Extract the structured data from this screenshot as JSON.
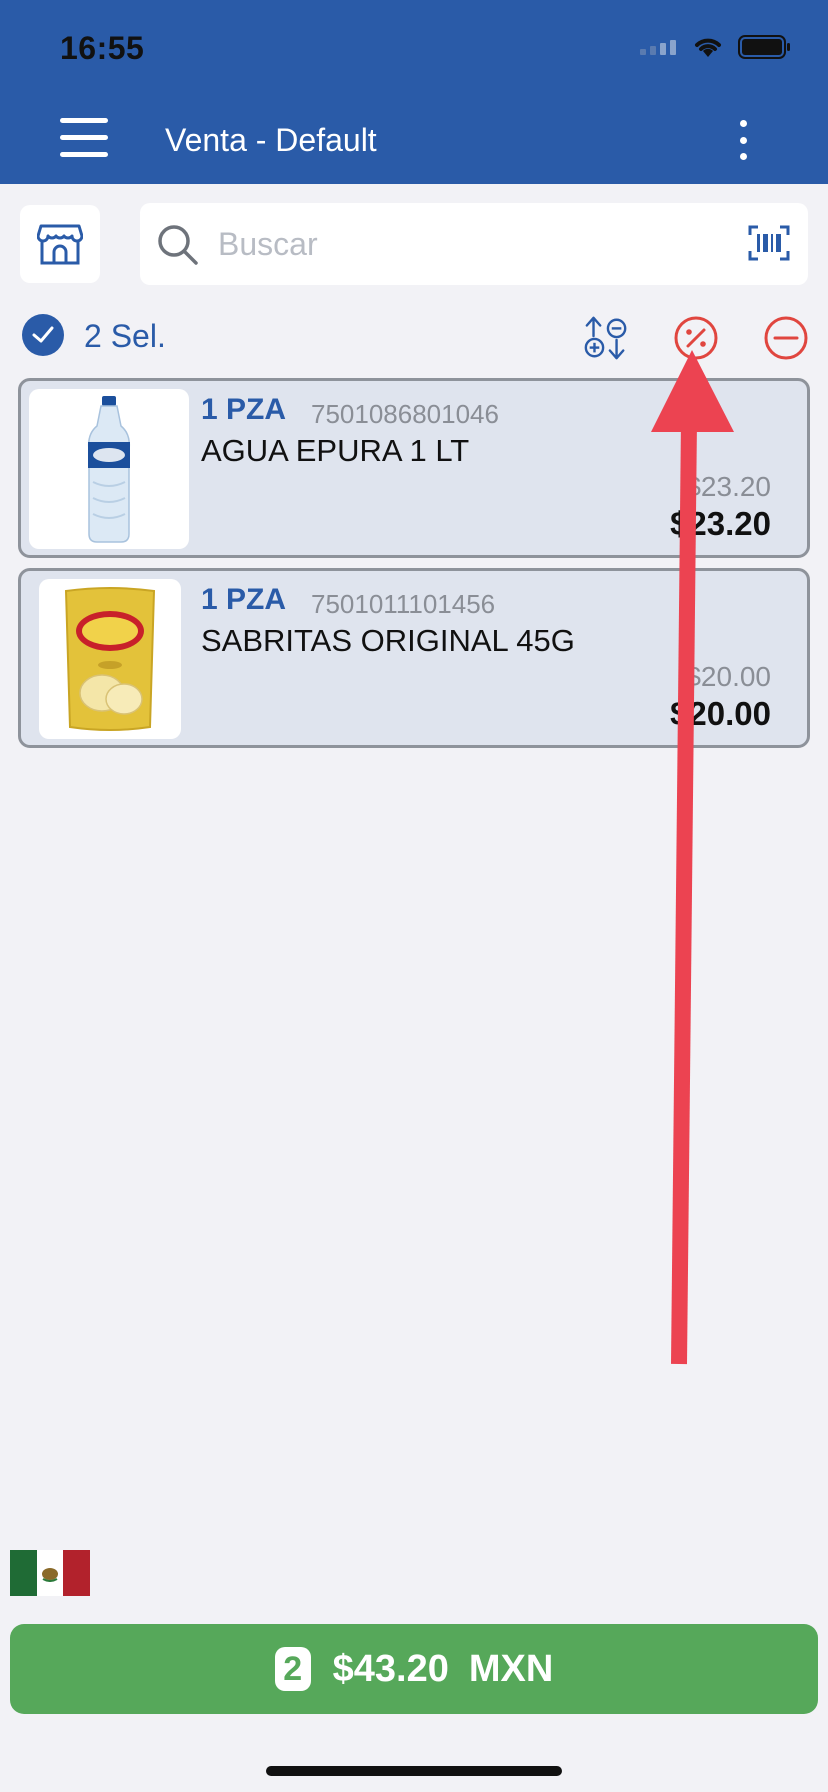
{
  "status_bar": {
    "time": "16:55"
  },
  "header": {
    "title": "Venta - Default"
  },
  "search": {
    "placeholder": "Buscar"
  },
  "selection": {
    "label": "2 Sel."
  },
  "items": [
    {
      "qty": "1 PZA",
      "code": "7501086801046",
      "name": "AGUA EPURA 1 LT",
      "old_price": "$23.20",
      "price": "$23.20",
      "image": "water-bottle"
    },
    {
      "qty": "1 PZA",
      "code": "7501011101456",
      "name": "SABRITAS ORIGINAL 45G",
      "old_price": "$20.00",
      "price": "$20.00",
      "image": "chips-bag"
    }
  ],
  "footer": {
    "count": "2",
    "total": "$43.20",
    "currency": "MXN"
  },
  "colors": {
    "primary": "#2a5ba8",
    "danger": "#e0463f",
    "success": "#56a85a",
    "annotation": "#ec4351"
  }
}
